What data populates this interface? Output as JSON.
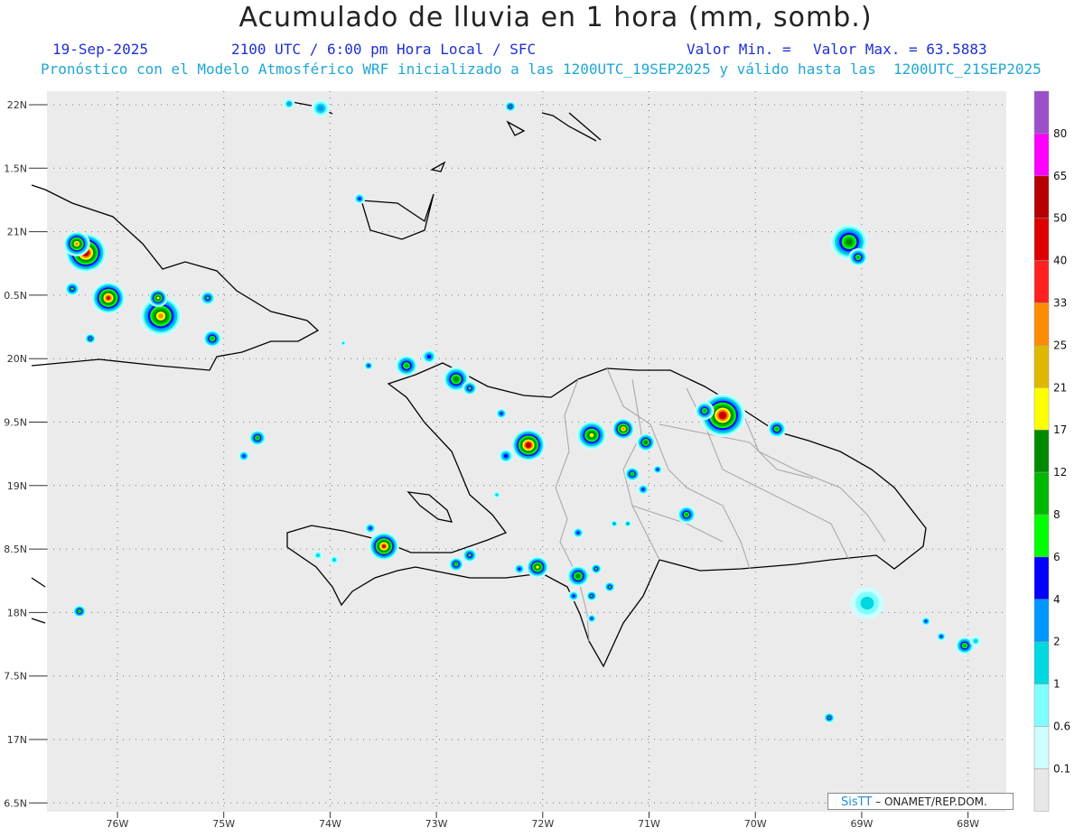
{
  "title": "Acumulado de lluvia en 1 hora (mm, somb.)",
  "date": "19-Sep-2025",
  "valid_time": "2100 UTC / 6:00 pm Hora Local / SFC",
  "valor_min": "Valor Min. =",
  "valor_max": "Valor Max. = 63.5883",
  "forecast_note": "Pronóstico con el Modelo Atmosférico WRF inicializado a las 1200UTC_19SEP2025 y válido hasta las  1200UTC_21SEP2025",
  "lat_labels": [
    "22N",
    "1.5N",
    "21N",
    "0.5N",
    "20N",
    "9.5N",
    "19N",
    "8.5N",
    "18N",
    "7.5N",
    "17N",
    "6.5N"
  ],
  "lon_labels": [
    "76W",
    "75W",
    "74W",
    "73W",
    "72W",
    "71W",
    "70W",
    "69W",
    "68W"
  ],
  "colorbar": {
    "labels": [
      "80",
      "65",
      "50",
      "40",
      "33",
      "25",
      "21",
      "17",
      "12",
      "8",
      "6",
      "4",
      "2",
      "1",
      "0.6",
      "0.1"
    ],
    "colors": [
      "#9b4fc8",
      "#ff00ff",
      "#b40000",
      "#dd0000",
      "#ff2020",
      "#ff8c00",
      "#e0b800",
      "#ffff00",
      "#008a00",
      "#00b800",
      "#00ff00",
      "#0000ff",
      "#0096ff",
      "#00d8e0",
      "#80ffff",
      "#cffcff",
      "#e8e8e8"
    ]
  },
  "credit": {
    "logo": "SisTT",
    "text": "– ONAMET/REP.DOM."
  }
}
